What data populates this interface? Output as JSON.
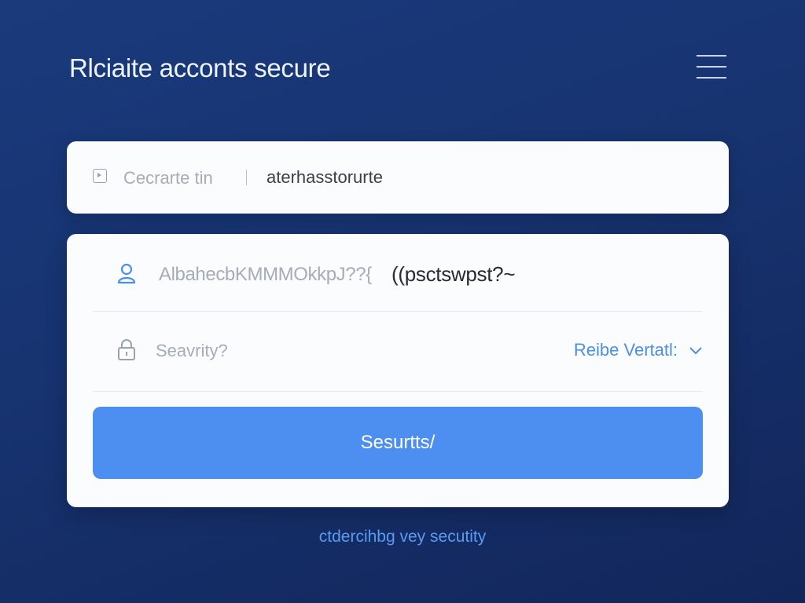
{
  "header": {
    "title": "Rlciaite acconts secure",
    "menu_icon": "hamburger-menu-icon"
  },
  "top_field": {
    "icon": "play-square-icon",
    "label": "Cecrarte tin",
    "value": "aterhasstorurte"
  },
  "form": {
    "password": {
      "icon": "user-icon",
      "placeholder": "AlbahecbKMMMOkkpJ??{",
      "value": "((psctswpst?~"
    },
    "security": {
      "icon": "lock-icon",
      "label": "Seavrity?",
      "selected_option": "Reibe Vertatl:",
      "chevron_icon": "chevron-down-icon"
    },
    "submit_label": "Sesurtts/"
  },
  "footer": {
    "link_text": "ctdercihbg vey secutity"
  },
  "colors": {
    "background_top": "#1a3a7c",
    "background_bottom": "#12265a",
    "accent": "#4d8ff0",
    "link": "#4a8fe8",
    "card": "#fbfcfe"
  }
}
